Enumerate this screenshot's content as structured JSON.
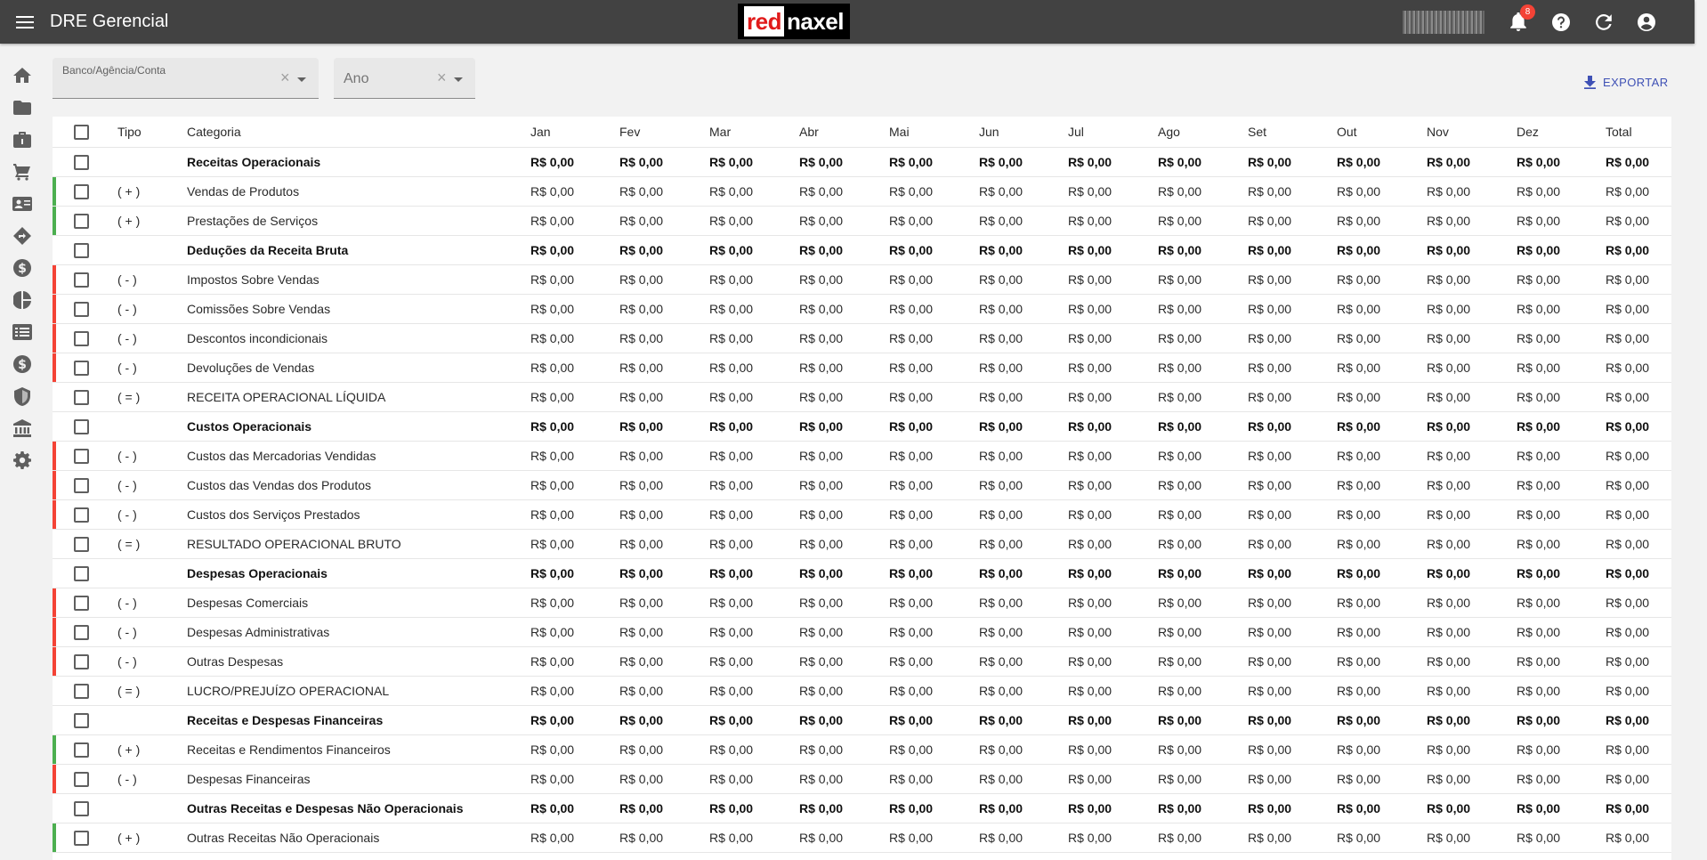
{
  "topbar": {
    "title": "DRE Gerencial",
    "logo": {
      "part1": "red",
      "part2": "naxel"
    },
    "notifications_count": "8",
    "icons": [
      "menu-icon",
      "bell-icon",
      "help-icon",
      "refresh-icon",
      "account-icon"
    ]
  },
  "sidebar": {
    "icons": [
      "home-icon",
      "folder-icon",
      "briefcase-icon",
      "cart-icon",
      "contact-card-icon",
      "directions-icon",
      "dollar-circle-icon",
      "pie-chart-icon",
      "list-icon",
      "dollar-circle-icon",
      "shield-icon",
      "bank-icon",
      "gear-icon"
    ]
  },
  "filters": {
    "conta_label": "Banco/Agência/Conta",
    "ano_label": "Ano"
  },
  "export_label": "EXPORTAR",
  "table": {
    "headers": {
      "tipo": "Tipo",
      "categoria": "Categoria",
      "months": [
        "Jan",
        "Fev",
        "Mar",
        "Abr",
        "Mai",
        "Jun",
        "Jul",
        "Ago",
        "Set",
        "Out",
        "Nov",
        "Dez",
        "Total"
      ]
    },
    "rows": [
      {
        "tipo": "",
        "categoria": "Receitas Operacionais",
        "bold": true,
        "bar": ""
      },
      {
        "tipo": "( + )",
        "categoria": "Vendas de Produtos",
        "bold": false,
        "bar": "green"
      },
      {
        "tipo": "( + )",
        "categoria": "Prestações de Serviços",
        "bold": false,
        "bar": "green"
      },
      {
        "tipo": "",
        "categoria": "Deduções da Receita Bruta",
        "bold": true,
        "bar": ""
      },
      {
        "tipo": "( - )",
        "categoria": "Impostos Sobre Vendas",
        "bold": false,
        "bar": "red"
      },
      {
        "tipo": "( - )",
        "categoria": "Comissões Sobre Vendas",
        "bold": false,
        "bar": "red"
      },
      {
        "tipo": "( - )",
        "categoria": "Descontos incondicionais",
        "bold": false,
        "bar": "red"
      },
      {
        "tipo": "( - )",
        "categoria": "Devoluções de Vendas",
        "bold": false,
        "bar": "red"
      },
      {
        "tipo": "( = )",
        "categoria": "RECEITA OPERACIONAL LÍQUIDA",
        "bold": false,
        "bar": ""
      },
      {
        "tipo": "",
        "categoria": "Custos Operacionais",
        "bold": true,
        "bar": ""
      },
      {
        "tipo": "( - )",
        "categoria": "Custos das Mercadorias Vendidas",
        "bold": false,
        "bar": "red"
      },
      {
        "tipo": "( - )",
        "categoria": "Custos das Vendas dos Produtos",
        "bold": false,
        "bar": "red"
      },
      {
        "tipo": "( - )",
        "categoria": "Custos dos Serviços Prestados",
        "bold": false,
        "bar": "red"
      },
      {
        "tipo": "( = )",
        "categoria": "RESULTADO OPERACIONAL BRUTO",
        "bold": false,
        "bar": ""
      },
      {
        "tipo": "",
        "categoria": "Despesas Operacionais",
        "bold": true,
        "bar": ""
      },
      {
        "tipo": "( - )",
        "categoria": "Despesas Comerciais",
        "bold": false,
        "bar": "red"
      },
      {
        "tipo": "( - )",
        "categoria": "Despesas Administrativas",
        "bold": false,
        "bar": "red"
      },
      {
        "tipo": "( - )",
        "categoria": "Outras Despesas",
        "bold": false,
        "bar": "red"
      },
      {
        "tipo": "( = )",
        "categoria": "LUCRO/PREJUÍZO OPERACIONAL",
        "bold": false,
        "bar": ""
      },
      {
        "tipo": "",
        "categoria": "Receitas e Despesas Financeiras",
        "bold": true,
        "bar": ""
      },
      {
        "tipo": "( + )",
        "categoria": "Receitas e Rendimentos Financeiros",
        "bold": false,
        "bar": "green"
      },
      {
        "tipo": "( - )",
        "categoria": "Despesas Financeiras",
        "bold": false,
        "bar": "red"
      },
      {
        "tipo": "",
        "categoria": "Outras Receitas e Despesas Não Operacionais",
        "bold": true,
        "bar": ""
      },
      {
        "tipo": "( + )",
        "categoria": "Outras Receitas Não Operacionais",
        "bold": false,
        "bar": "green"
      }
    ],
    "cell_value": "R$ 0,00"
  },
  "colors": {
    "topbar": "#424242",
    "positive": "#4caf50",
    "negative": "#f44336",
    "accent": "#3f51b5"
  }
}
